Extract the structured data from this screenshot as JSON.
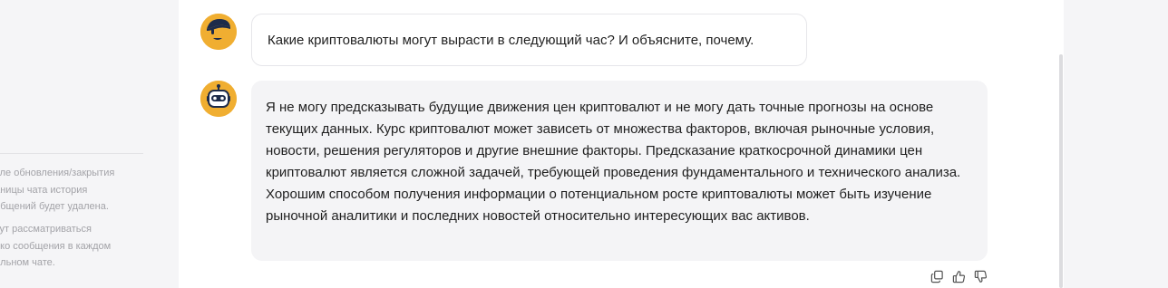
{
  "sidebar": {
    "note_history": "осле обновления/закрытия\nраницы чата история\nообщений будет удалена.",
    "note_context": "удут рассматриваться\nлько сообщения в каждом\nдельном чате."
  },
  "messages": {
    "user": {
      "text": "Какие криптовалюты могут вырасти в следующий час? И объясните, почему.",
      "avatar_icon": "user-avatar-icon"
    },
    "bot": {
      "text": "Я не могу предсказывать будущие движения цен криптовалют и не могу дать точные прогнозы на основе текущих данных. Курс криптовалют может зависеть от множества факторов, включая рыночные условия, новости, решения регуляторов и другие внешние факторы. Предсказание краткосрочной динамики цен криптовалют является сложной задачей, требующей проведения фундаментального и технического анализа. Хорошим способом получения информации о потенциальном росте криптовалюты может быть изучение рыночной аналитики и последних новостей относительно интересующих вас активов.",
      "avatar_icon": "robot-avatar-icon"
    }
  },
  "actions": {
    "icons": [
      "copy-icon",
      "thumbs-up-icon",
      "thumbs-down-icon"
    ]
  },
  "colors": {
    "avatar": "#f0ae31",
    "bot_bubble": "#f4f4f6",
    "page_bg": "#f5f5f7"
  }
}
